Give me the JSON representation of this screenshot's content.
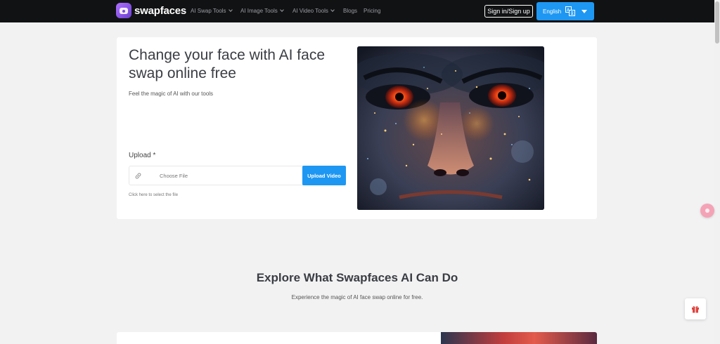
{
  "header": {
    "logo_text": "swapfaces",
    "nav": [
      {
        "label": "AI Swap Tools",
        "dropdown": true
      },
      {
        "label": "AI Image Tools",
        "dropdown": true
      },
      {
        "label": "AI Video Tools",
        "dropdown": true
      },
      {
        "label": "Blogs",
        "dropdown": false
      },
      {
        "label": "Pricing",
        "dropdown": false
      }
    ],
    "signin_label": "Sign in/Sign up",
    "language_label": "English",
    "accent_color": "#1e97f3"
  },
  "hero": {
    "title": "Change your face with AI face swap online free",
    "subtitle": "Feel the magic of AI with our tools",
    "upload_label": "Upload *",
    "file_placeholder": "Choose File",
    "upload_button": "Upload Video",
    "upload_hint": "Click here to select the file"
  },
  "explore": {
    "title": "Explore What Swapfaces AI Can Do",
    "subtitle": "Experience the magic of AI face swap online for free."
  },
  "icons": [
    "logo-icon",
    "chevron-down-icon",
    "translate-icon",
    "link-icon",
    "gift-icon"
  ]
}
